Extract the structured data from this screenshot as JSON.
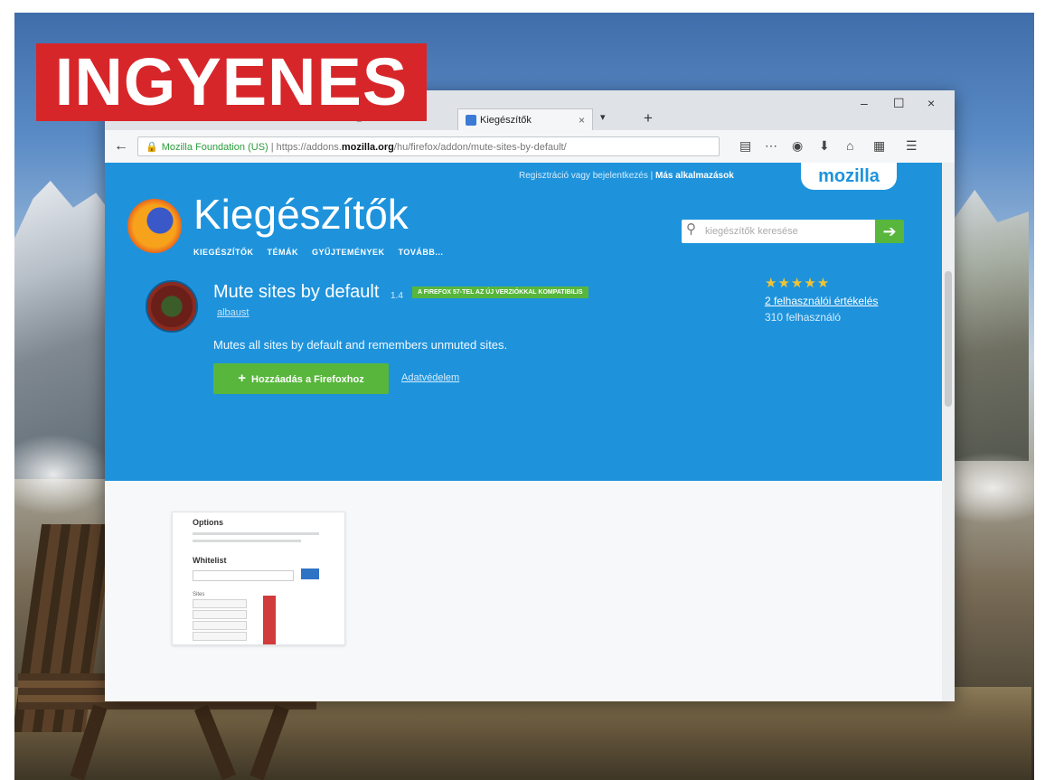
{
  "badge": "INGYENES",
  "browser": {
    "tabs": [
      {
        "label": "■ ×"
      },
      {
        "label": "Kiegészítők",
        "close": "×"
      }
    ],
    "tab_menu": "▾",
    "new_tab": "+",
    "window_controls": {
      "minimize": "–",
      "maximize": "☐",
      "close": "×"
    },
    "url": {
      "secure_text": "Mozilla Foundation (US)",
      "prefix": " | https://addons.",
      "domain": "mozilla.org",
      "path": "/hu/firefox/addon/mute-sites-by-default/"
    },
    "toolbar_icons": [
      "reader-view-icon",
      "page-actions-icon",
      "pocket-icon",
      "download-icon",
      "home-icon",
      "library-icon",
      "menu-icon"
    ]
  },
  "page": {
    "top_nav": {
      "links": "Regisztráció vagy bejelentkezés",
      "separator": "|",
      "other": "Más alkalmazások"
    },
    "mozilla": "mozilla",
    "brand": "Kiegészítők",
    "subnav": [
      "KIEGÉSZÍTŐK",
      "TÉMÁK",
      "GYŰJTEMÉNYEK",
      "TOVÁBB..."
    ],
    "search_placeholder": "kiegészítők keresése",
    "search_button": "➔",
    "addon": {
      "name": "Mute sites by default",
      "version": "1.4",
      "compat_badge": "A FIREFOX 57-TEL AZ ÚJ VERZIÓKKAL KOMPATIBILIS",
      "author": "albaust",
      "description": "Mutes all sites by default and remembers unmuted sites.",
      "add_button": "Hozzáadás a Firefoxhoz",
      "add_button_plus": "+",
      "privacy_link": "Adatvédelem",
      "stars": "★★★★★",
      "rating": 5,
      "reviews": "2 felhasználói értékelés",
      "users": "310 felhasználó"
    },
    "preview": {
      "title": "Options",
      "section": "Whitelist",
      "label": "Sites"
    }
  },
  "colors": {
    "badge": "#d7262a",
    "hero": "#1e93dc",
    "green": "#57b63b"
  }
}
